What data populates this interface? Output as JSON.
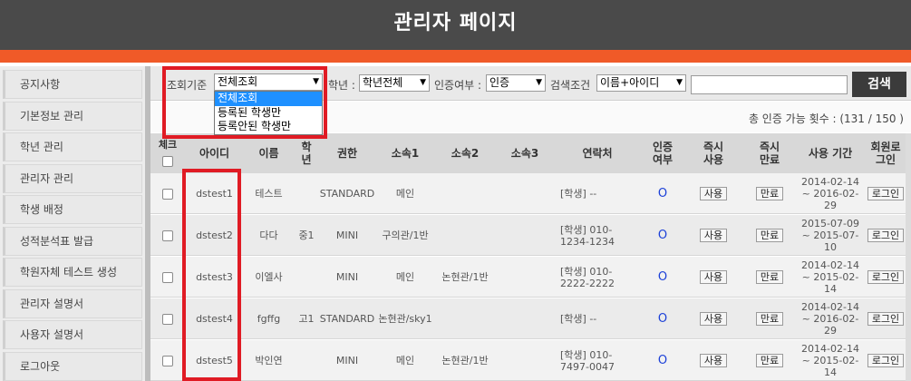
{
  "header": {
    "title": "관리자 페이지"
  },
  "sidebar": {
    "items": [
      "공지사항",
      "기본정보 관리",
      "학년 관리",
      "관리자 관리",
      "학생 배정",
      "성적분석표 발급",
      "학원자체 테스트 생성",
      "관리자 설명서",
      "사용자 설명서",
      "로그아웃"
    ]
  },
  "filters": {
    "basis_label": "조회기준",
    "basis_value": "전체조회",
    "basis_options": [
      "전체조회",
      "등록된 학생만",
      "등록안된 학생만"
    ],
    "grade_label": "학년 :",
    "grade_value": "학년전체",
    "cert_label": "인증여부 :",
    "cert_value": "인증",
    "search_label": "검색조건",
    "search_value": "이름+아이디",
    "search_text": "",
    "search_button": "검색"
  },
  "count_text": "총 인증 가능 횟수 : (131 / 150 )",
  "table": {
    "headers": {
      "check": "체크",
      "id": "아이디",
      "name": "이름",
      "grade": "학년",
      "role": "권한",
      "dept1": "소속1",
      "dept2": "소속2",
      "dept3": "소속3",
      "contact": "연락처",
      "cert": "인증여부",
      "use_now": "즉시사용",
      "end_now": "즉시만료",
      "period": "사용 기간",
      "login": "회원로그인"
    },
    "use_label": "사용",
    "end_label": "만료",
    "login_label": "로그인",
    "rows": [
      {
        "id": "dstest1",
        "name": "테스트",
        "grade": "",
        "role": "STANDARD",
        "dept1": "메인",
        "dept2": "",
        "dept3": "",
        "contact": "[학생] --",
        "cert": "O",
        "period": "2014-02-14 ~ 2016-02-29"
      },
      {
        "id": "dstest2",
        "name": "다다",
        "grade": "중1",
        "role": "MINI",
        "dept1": "구의관/1반",
        "dept2": "",
        "dept3": "",
        "contact": "[학생] 010-1234-1234",
        "cert": "O",
        "period": "2015-07-09 ~ 2015-07-10"
      },
      {
        "id": "dstest3",
        "name": "이엘사",
        "grade": "",
        "role": "MINI",
        "dept1": "메인",
        "dept2": "논현관/1반",
        "dept3": "",
        "contact": "[학생] 010-2222-2222",
        "cert": "O",
        "period": "2014-02-14 ~ 2015-02-14"
      },
      {
        "id": "dstest4",
        "name": "fgffg",
        "grade": "고1",
        "role": "STANDARD",
        "dept1": "논현관/sky1",
        "dept2": "",
        "dept3": "",
        "contact": "[학생] --",
        "cert": "O",
        "period": "2014-02-14 ~ 2016-02-29"
      },
      {
        "id": "dstest5",
        "name": "박인연",
        "grade": "",
        "role": "MINI",
        "dept1": "메인",
        "dept2": "논현관/1반",
        "dept3": "",
        "contact": "[학생] 010-7497-0047",
        "cert": "O",
        "period": "2014-02-14 ~ 2015-02-14"
      }
    ]
  },
  "colors": {
    "header_bg": "#4a4a4a",
    "accent": "#f05a28",
    "highlight": "#e01b24",
    "selected_option": "#1e90ff",
    "cert_ok": "#1a3fd8"
  }
}
